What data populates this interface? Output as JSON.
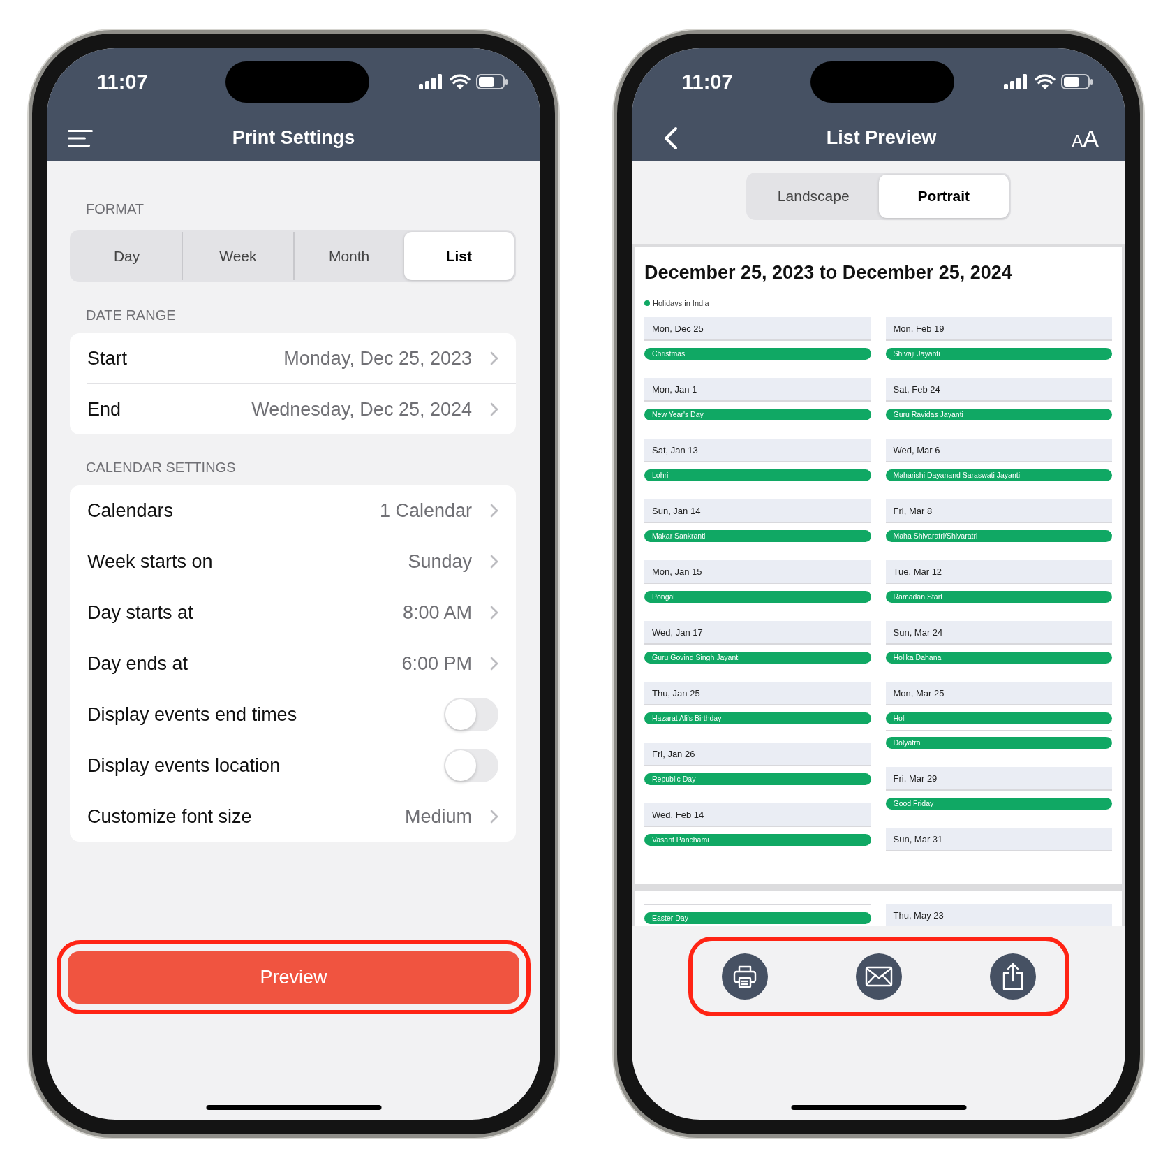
{
  "settings_screen": {
    "status_time": "11:07",
    "title": "Print Settings",
    "sections": [
      {
        "heading": "FORMAT",
        "kind": "segmented",
        "options": [
          {
            "label": "Day",
            "selected": false
          },
          {
            "label": "Week",
            "selected": false
          },
          {
            "label": "Month",
            "selected": false
          },
          {
            "label": "List",
            "selected": true
          }
        ]
      },
      {
        "heading": "DATE RANGE",
        "kind": "list",
        "rows": [
          {
            "kind": "value",
            "label": "Start",
            "value": "Monday, Dec 25, 2023"
          },
          {
            "kind": "value",
            "label": "End",
            "value": "Wednesday, Dec 25, 2024"
          }
        ]
      },
      {
        "heading": "CALENDAR SETTINGS",
        "kind": "list",
        "rows": [
          {
            "kind": "value",
            "label": "Calendars",
            "value": "1 Calendar"
          },
          {
            "kind": "value",
            "label": "Week starts on",
            "value": "Sunday"
          },
          {
            "kind": "value",
            "label": "Day starts at",
            "value": "8:00 AM"
          },
          {
            "kind": "value",
            "label": "Day ends at",
            "value": "6:00 PM"
          },
          {
            "kind": "toggle",
            "label": "Display events end times",
            "on": false
          },
          {
            "kind": "toggle",
            "label": "Display events location",
            "on": false
          },
          {
            "kind": "value",
            "label": "Customize font size",
            "value": "Medium"
          }
        ]
      }
    ],
    "preview_button": {
      "label": "Preview",
      "highlighted": true
    }
  },
  "preview_screen": {
    "status_time": "11:07",
    "title": "List Preview",
    "text_size_button": "AA",
    "orientation": [
      {
        "label": "Landscape",
        "selected": false
      },
      {
        "label": "Portrait",
        "selected": true
      }
    ],
    "pages": [
      {
        "title": "December 25, 2023 to December 25, 2024",
        "legend": {
          "label": "Holidays in India",
          "color": "#10a864"
        },
        "columns": [
          [
            {
              "date": "Mon, Dec 25",
              "events": [
                "Christmas"
              ]
            },
            {
              "date": "Mon, Jan 1",
              "events": [
                "New Year's Day"
              ]
            },
            {
              "date": "Sat, Jan 13",
              "events": [
                "Lohri"
              ]
            },
            {
              "date": "Sun, Jan 14",
              "events": [
                "Makar Sankranti"
              ]
            },
            {
              "date": "Mon, Jan 15",
              "events": [
                "Pongal"
              ]
            },
            {
              "date": "Wed, Jan 17",
              "events": [
                "Guru Govind Singh Jayanti"
              ]
            },
            {
              "date": "Thu, Jan 25",
              "events": [
                "Hazarat Ali's Birthday"
              ]
            },
            {
              "date": "Fri, Jan 26",
              "events": [
                "Republic Day"
              ]
            },
            {
              "date": "Wed, Feb 14",
              "events": [
                "Vasant Panchami"
              ]
            }
          ],
          [
            {
              "date": "Mon, Feb 19",
              "events": [
                "Shivaji Jayanti"
              ]
            },
            {
              "date": "Sat, Feb 24",
              "events": [
                "Guru Ravidas Jayanti"
              ]
            },
            {
              "date": "Wed, Mar 6",
              "events": [
                "Maharishi Dayanand Saraswati Jayanti"
              ]
            },
            {
              "date": "Fri, Mar 8",
              "events": [
                "Maha Shivaratri/Shivaratri"
              ]
            },
            {
              "date": "Tue, Mar 12",
              "events": [
                "Ramadan Start"
              ]
            },
            {
              "date": "Sun, Mar 24",
              "events": [
                "Holika Dahana"
              ]
            },
            {
              "date": "Mon, Mar 25",
              "events": [
                "Holi",
                "Dolyatra"
              ]
            },
            {
              "date": "Fri, Mar 29",
              "events": [
                "Good Friday"
              ]
            },
            {
              "date": "Sun, Mar 31"
            }
          ]
        ]
      },
      {
        "columns": [
          [
            {
              "events": [
                "Easter Day"
              ]
            }
          ],
          [
            {
              "date": "Thu, May 23"
            }
          ]
        ]
      }
    ],
    "actions": {
      "highlighted": true,
      "buttons": [
        {
          "kind": "print"
        },
        {
          "kind": "email"
        },
        {
          "kind": "share"
        }
      ]
    }
  }
}
